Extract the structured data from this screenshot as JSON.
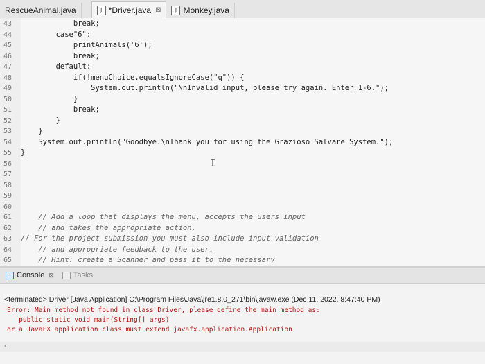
{
  "tabs": [
    {
      "label": "RescueAnimal.java",
      "active": false,
      "closable": false
    },
    {
      "label": "*Driver.java",
      "active": true,
      "closable": true
    },
    {
      "label": "Monkey.java",
      "active": false,
      "closable": false
    }
  ],
  "tab_close_glyph": "⊠",
  "code": [
    {
      "num": "43",
      "text": "            break;"
    },
    {
      "num": "44",
      "text": "        case\"6\":"
    },
    {
      "num": "45",
      "text": "            printAnimals('6');"
    },
    {
      "num": "46",
      "text": "            break;"
    },
    {
      "num": "47",
      "text": "        default:"
    },
    {
      "num": "48",
      "text": "            if(!menuChoice.equalsIgnoreCase(\"q\")) {"
    },
    {
      "num": "49",
      "text": "                System.out.println(\"\\nInvalid input, please try again. Enter 1-6.\");"
    },
    {
      "num": "50",
      "text": "            }"
    },
    {
      "num": "51",
      "text": "            break;"
    },
    {
      "num": "52",
      "text": "        }"
    },
    {
      "num": "53",
      "text": "    }"
    },
    {
      "num": "54",
      "text": "    System.out.println(\"Goodbye.\\nThank you for using the Grazioso Salvare System.\");"
    },
    {
      "num": "55",
      "text": "}"
    },
    {
      "num": "56",
      "text": ""
    },
    {
      "num": "57",
      "text": ""
    },
    {
      "num": "58",
      "text": ""
    },
    {
      "num": "59",
      "text": ""
    },
    {
      "num": "60",
      "text": ""
    },
    {
      "num": "61",
      "text": "    // Add a loop that displays the menu, accepts the users input"
    },
    {
      "num": "62",
      "text": "    // and takes the appropriate action."
    },
    {
      "num": "63",
      "text": "// For the project submission you must also include input validation"
    },
    {
      "num": "64",
      "text": "    // and appropriate feedback to the user."
    },
    {
      "num": "65",
      "text": "    // Hint: create a Scanner and pass it to the necessary"
    }
  ],
  "cursor_glyph": "I",
  "console": {
    "tab_label": "Console",
    "tasks_label": "Tasks",
    "terminated": "<terminated> Driver [Java Application] C:\\Program Files\\Java\\jre1.8.0_271\\bin\\javaw.exe (Dec 11, 2022, 8:47:40 PM)",
    "errors": [
      "Error: Main method not found in class Driver, please define the main method as:",
      "   public static void main(String[] args)",
      "or a JavaFX application class must extend javafx.application.Application"
    ],
    "scroll_arrow": "‹"
  }
}
